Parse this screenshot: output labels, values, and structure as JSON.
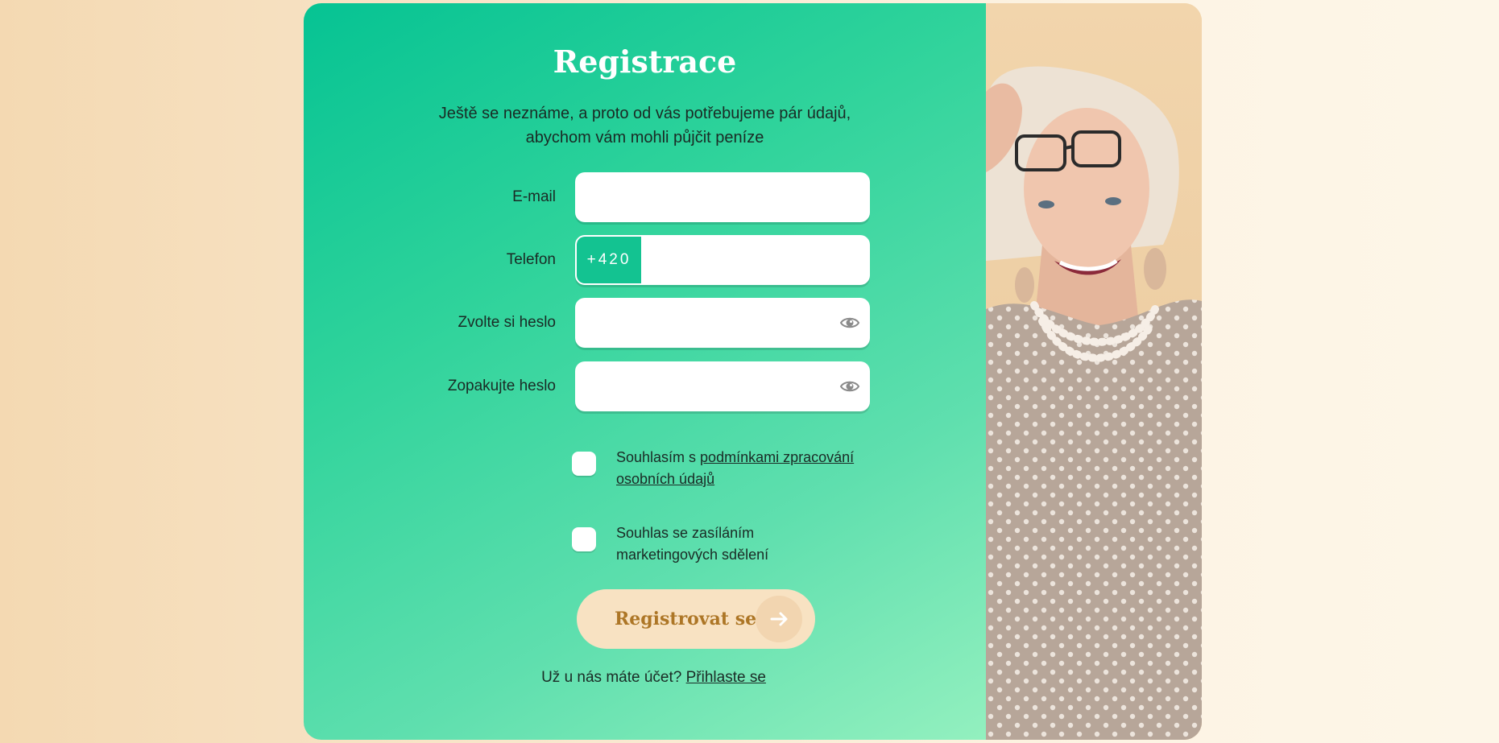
{
  "form": {
    "title": "Registrace",
    "subtitle_line1": "Ještě se neznáme, a proto od vás potřebujeme pár údajů,",
    "subtitle_line2": "abychom vám mohli půjčit peníze",
    "email_label": "E-mail",
    "email_value": "",
    "phone_label": "Telefon",
    "phone_prefix": "+420",
    "phone_value": "",
    "password_label": "Zvolte si heslo",
    "password_value": "",
    "password_repeat_label": "Zopakujte heslo",
    "password_repeat_value": "",
    "consent_personal_prefix": "Souhlasím s ",
    "consent_personal_link": "podmínkami zpracování osobních údajů",
    "consent_personal_checked": false,
    "consent_marketing_label": "Souhlas se zasíláním marketingových sdělení",
    "consent_marketing_checked": false,
    "submit_label": "Registrovat se",
    "login_prompt": "Už u nás máte účet?",
    "login_link": "Přihlaste se"
  },
  "icons": {
    "password_toggle": "eye-icon",
    "submit_arrow": "arrow-right-icon"
  },
  "colors": {
    "form_gradient_start": "#06c393",
    "form_gradient_end": "#93f0bf",
    "prefix_bg": "#13c391",
    "button_bg": "#f8e2c2",
    "button_text": "#ad7626"
  }
}
